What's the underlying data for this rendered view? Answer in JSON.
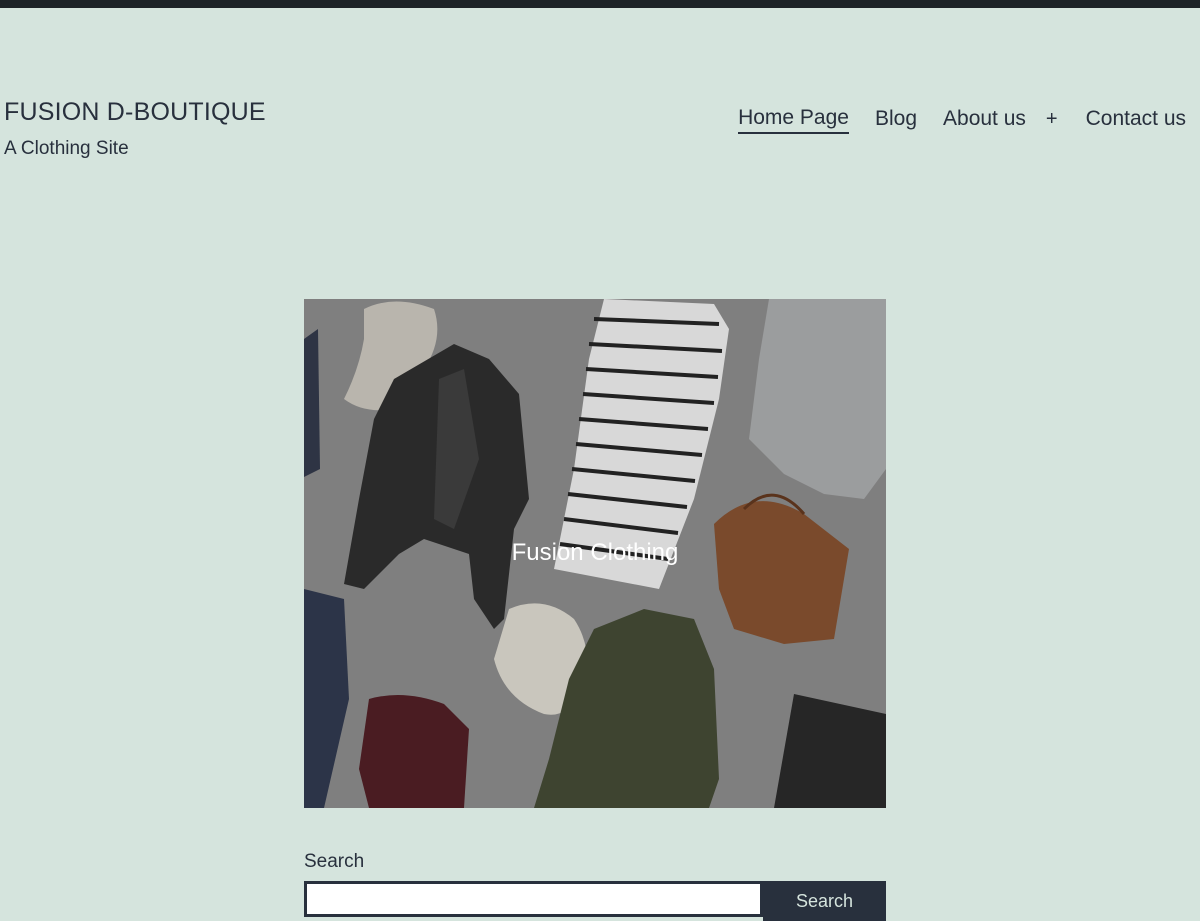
{
  "site": {
    "title": "FUSION D-BOUTIQUE",
    "tagline": "A Clothing Site"
  },
  "nav": {
    "items": [
      {
        "label": "Home Page",
        "current": true
      },
      {
        "label": "Blog"
      },
      {
        "label": "About us"
      },
      {
        "label": "Contact us"
      }
    ],
    "expand_symbol": "+"
  },
  "cover": {
    "heading": "Fusion Clothing",
    "overlay_color": "#808080"
  },
  "search": {
    "label": "Search",
    "input_value": "",
    "button_label": "Search"
  },
  "colors": {
    "background": "#d5e4dd",
    "text": "#28303d",
    "admin_bar": "#1d2327"
  }
}
